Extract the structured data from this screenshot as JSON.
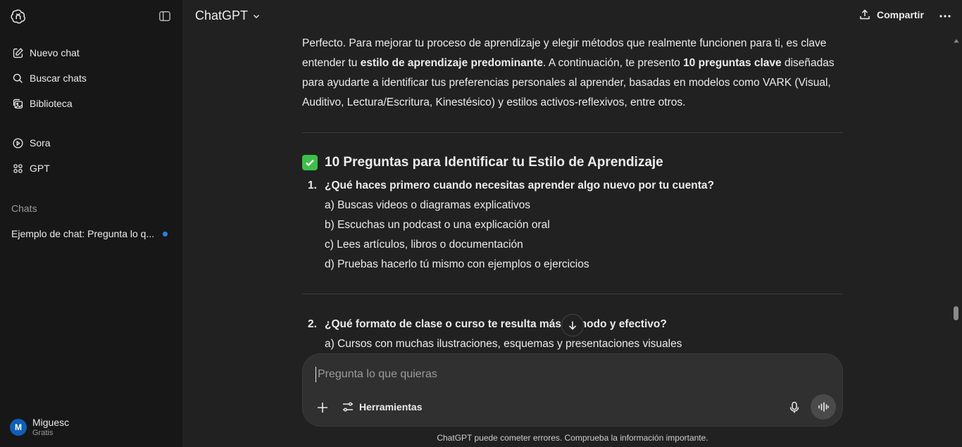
{
  "sidebar": {
    "items": [
      {
        "label": "Nuevo chat",
        "icon": "edit-icon"
      },
      {
        "label": "Buscar chats",
        "icon": "search-icon"
      },
      {
        "label": "Biblioteca",
        "icon": "library-icon"
      },
      {
        "label": "Sora",
        "icon": "play-icon"
      },
      {
        "label": "GPT",
        "icon": "grid-icon"
      }
    ],
    "section_label": "Chats",
    "chats": [
      {
        "label": "Ejemplo de chat: Pregunta lo q..."
      }
    ],
    "user": {
      "initial": "M",
      "name": "Miguesc",
      "plan": "Gratis"
    }
  },
  "header": {
    "model": "ChatGPT",
    "share_label": "Compartir"
  },
  "message": {
    "intro": {
      "p1": "Perfecto. Para mejorar tu proceso de aprendizaje y elegir métodos que realmente funcionen para ti, es clave entender tu ",
      "b1": "estilo de aprendizaje predominante",
      "p2": ". A continuación, te presento ",
      "b2": "10 preguntas clave",
      "p3": " diseñadas para ayudarte a identificar tus preferencias personales al aprender, basadas en modelos como VARK (Visual, Auditivo, Lectura/Escritura, Kinestésico) y estilos activos-reflexivos, entre otros."
    },
    "heading": "10 Preguntas para Identificar tu Estilo de Aprendizaje",
    "questions": [
      {
        "num": "1.",
        "text": "¿Qué haces primero cuando necesitas aprender algo nuevo por tu cuenta?",
        "options": [
          "a) Buscas videos o diagramas explicativos",
          "b) Escuchas un podcast o una explicación oral",
          "c) Lees artículos, libros o documentación",
          "d) Pruebas hacerlo tú mismo con ejemplos o ejercicios"
        ]
      },
      {
        "num": "2.",
        "text": "¿Qué formato de clase o curso te resulta más cómodo y efectivo?",
        "options": [
          "a) Cursos con muchas ilustraciones, esquemas y presentaciones visuales"
        ]
      }
    ]
  },
  "composer": {
    "placeholder": "Pregunta lo que quieras",
    "tools_label": "Herramientas"
  },
  "disclaimer": "ChatGPT puede cometer errores. Comprueba la información importante.",
  "colors": {
    "accent_dot": "#2f7fe0",
    "avatar": "#0f5fb7",
    "check": "#3dbf4a"
  }
}
